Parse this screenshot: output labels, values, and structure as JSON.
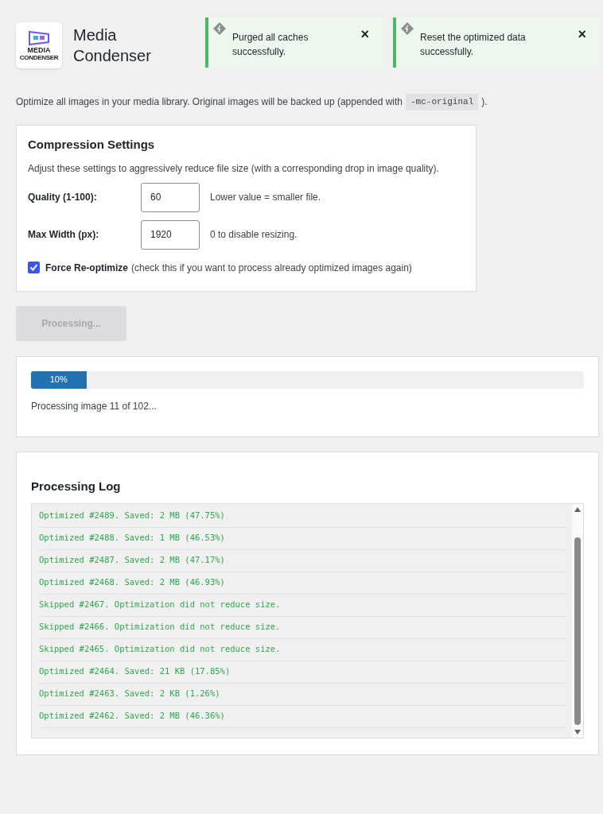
{
  "app": {
    "logo_text": [
      "MEDIA",
      "CONDENSER"
    ],
    "title": "Media Condenser"
  },
  "notices": [
    {
      "text": "Purged all caches successfully.",
      "close": "×"
    },
    {
      "text": "Reset the optimized data successfully.",
      "close": "×"
    }
  ],
  "description": {
    "before": "Optimize all images in your media library. Original images will be backed up (appended with",
    "code": "-mc-original",
    "after": ")."
  },
  "settings": {
    "title": "Compression Settings",
    "intro": "Adjust these settings to aggressively reduce file size (with a corresponding drop in image quality).",
    "fields": [
      {
        "label": "Quality (1-100):",
        "value": "60",
        "hint": "Lower value = smaller file."
      },
      {
        "label": "Max Width (px):",
        "value": "1920",
        "hint": "0 to disable resizing."
      }
    ],
    "force": {
      "label": "Force Re-optimize",
      "note": "(check this if you want to process already optimized images again)",
      "checked": true
    }
  },
  "process_button": {
    "label": "Processing...",
    "disabled": true
  },
  "progress": {
    "level": 0.1,
    "label": "10%",
    "status": "Processing image 11 of 102..."
  },
  "log": {
    "title": "Processing Log",
    "entries": [
      "Optimized #2489. Saved: 2 MB (47.75%)",
      "Optimized #2488. Saved: 1 MB (46.53%)",
      "Optimized #2487. Saved: 2 MB (47.17%)",
      "Optimized #2468. Saved: 2 MB (46.93%)",
      "Skipped #2467. Optimization did not reduce size.",
      "Skipped #2466. Optimization did not reduce size.",
      "Skipped #2465. Optimization did not reduce size.",
      "Optimized #2464. Saved: 21 KB (17.85%)",
      "Optimized #2463. Saved: 2 KB (1.26%)",
      "Optimized #2462. Saved: 2 MB (46.36%)"
    ]
  }
}
